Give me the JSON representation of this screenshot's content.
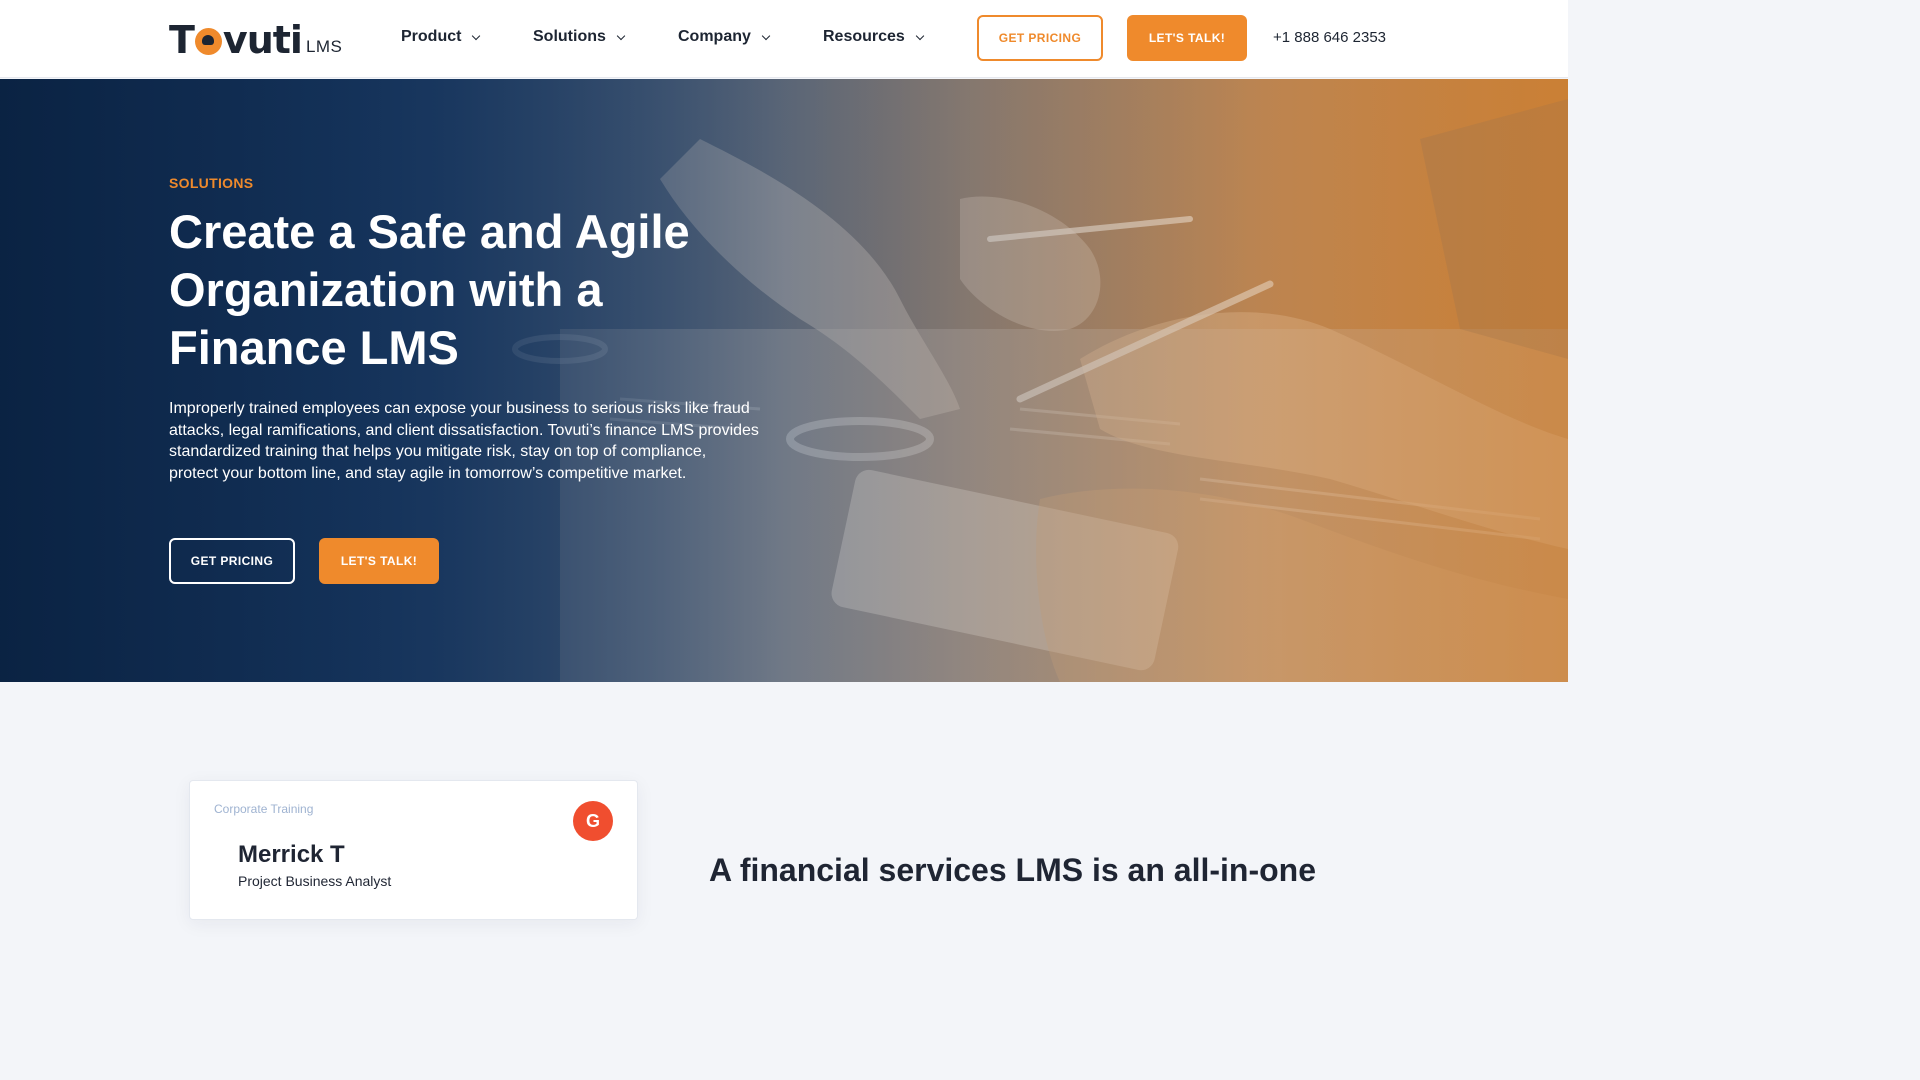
{
  "header": {
    "logo_text": "Tovuti",
    "logo_suffix": "LMS",
    "nav": [
      {
        "label": "Product"
      },
      {
        "label": "Solutions"
      },
      {
        "label": "Company"
      },
      {
        "label": "Resources"
      }
    ],
    "get_pricing_label": "GET PRICING",
    "lets_talk_label": "LET'S TALK!",
    "phone": "+1 888 646 2353"
  },
  "hero": {
    "eyebrow": "SOLUTIONS",
    "title": "Create a Safe and Agile Organization with a Finance LMS",
    "body": "Improperly trained employees can expose your business to serious risks like fraud attacks, legal ramifications, and client dissatisfaction. Tovuti’s finance LMS provides standardized training that helps you mitigate risk, stay on top of compliance, protect your bottom line, and stay agile in tomorrow’s competitive market.",
    "get_pricing_label": "GET PRICING",
    "lets_talk_label": "LET'S TALK!"
  },
  "review": {
    "category": "Corporate Training",
    "badge": "G",
    "name": "Merrick T",
    "role": "Project Business Analyst"
  },
  "section": {
    "heading": "A financial services LMS is an all-in-one"
  },
  "colors": {
    "accent": "#ef8a2c",
    "hero_dark": "#0f2b4e",
    "g2_red": "#f04e2f"
  }
}
